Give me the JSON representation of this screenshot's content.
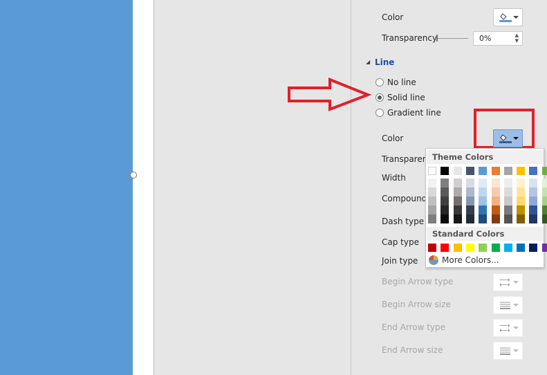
{
  "fill": {
    "color_label": "Color",
    "transparency_label": "Transparency",
    "transparency_value": "0%"
  },
  "line": {
    "section_title": "Line",
    "options": [
      {
        "label": "No line",
        "selected": false
      },
      {
        "label": "Solid line",
        "selected": true
      },
      {
        "label": "Gradient line",
        "selected": false
      }
    ],
    "color_label": "Color",
    "transparency_label": "Transparency",
    "width_label": "Width",
    "compound_label": "Compound type",
    "dash_label": "Dash type",
    "cap_label": "Cap type",
    "join_label": "Join type",
    "begin_arrow_type": "Begin Arrow type",
    "begin_arrow_size": "Begin Arrow size",
    "end_arrow_type": "End Arrow type",
    "end_arrow_size": "End Arrow size"
  },
  "palette": {
    "theme_title": "Theme Colors",
    "standard_title": "Standard Colors",
    "more_colors": "More Colors...",
    "theme": [
      "#ffffff",
      "#000000",
      "#e7e6e6",
      "#44546a",
      "#5b9bd5",
      "#ed7d31",
      "#a5a5a5",
      "#ffc000",
      "#4472c4",
      "#70ad47"
    ],
    "shades": [
      [
        "#f2f2f2",
        "#7f7f7f",
        "#d0cece",
        "#d6dce4",
        "#deebf6",
        "#fbe5d5",
        "#ededed",
        "#fff2cc",
        "#dae3f3",
        "#e2efd9"
      ],
      [
        "#d8d8d8",
        "#595959",
        "#aeabab",
        "#adb9ca",
        "#bdd7ee",
        "#f7cbac",
        "#dbdbdb",
        "#fee599",
        "#b4c6e7",
        "#c5e0b3"
      ],
      [
        "#bfbfbf",
        "#3f3f3f",
        "#757070",
        "#8496b0",
        "#9dc3e6",
        "#f4b183",
        "#c9c9c9",
        "#ffd965",
        "#8eaadb",
        "#a8d08d"
      ],
      [
        "#a5a5a5",
        "#262626",
        "#3a3838",
        "#323f4f",
        "#2e75b5",
        "#c55a11",
        "#7b7b7b",
        "#bf9000",
        "#2f5496",
        "#538135"
      ],
      [
        "#7f7f7f",
        "#0c0c0c",
        "#171616",
        "#222a35",
        "#1e4e79",
        "#843c0b",
        "#525252",
        "#7f6000",
        "#1f3864",
        "#375623"
      ]
    ],
    "standard": [
      "#c00000",
      "#ff0000",
      "#ffc000",
      "#ffff00",
      "#92d050",
      "#00b050",
      "#00b0f0",
      "#0070c0",
      "#002060",
      "#7030a0"
    ]
  },
  "annotation_color": "#e0202a"
}
